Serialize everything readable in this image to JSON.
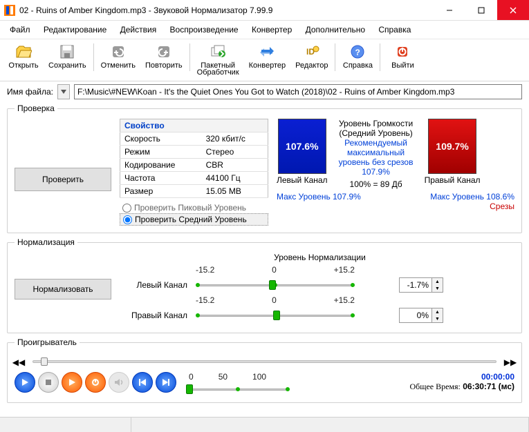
{
  "window": {
    "title": "02 - Ruins of Amber Kingdom.mp3 - Звуковой Нормализатор 7.99.9"
  },
  "menu": {
    "items": [
      "Файл",
      "Редактирование",
      "Действия",
      "Воспроизведение",
      "Конвертер",
      "Дополнительно",
      "Справка"
    ]
  },
  "toolbar": {
    "open": "Открыть",
    "save": "Сохранить",
    "undo": "Отменить",
    "redo": "Повторить",
    "batch_l1": "Пакетный",
    "batch_l2": "Обработчик",
    "converter": "Конвертер",
    "editor": "Редактор",
    "help": "Справка",
    "exit": "Выйти"
  },
  "file": {
    "label": "Имя файла:",
    "path": "F:\\Music\\#NEW\\Koan - It's the Quiet Ones You Got to Watch (2018)\\02 - Ruins of Amber Kingdom.mp3"
  },
  "check": {
    "legend": "Проверка",
    "button": "Проверить",
    "prop_header": "Свойство",
    "rows": {
      "speed_k": "Скорость",
      "speed_v": "320 кбит/с",
      "mode_k": "Режим",
      "mode_v": "Стерео",
      "enc_k": "Кодирование",
      "enc_v": "CBR",
      "freq_k": "Частота",
      "freq_v": "44100 Гц",
      "size_k": "Размер",
      "size_v": "15.05 MB"
    },
    "radio_peak": "Проверить Пиковый Уровень",
    "radio_avg": "Проверить Средний Уровень",
    "meter": {
      "left_label": "Левый Канал",
      "right_label": "Правый Канал",
      "left_value": "107.6%",
      "right_value": "109.7%",
      "loud_l1": "Уровень Громкости",
      "loud_l2": "(Средний Уровень)",
      "rec_l1": "Рекомендуемый",
      "rec_l2": "максимальный",
      "rec_l3": "уровень без срезов",
      "rec_val": "107.9%",
      "eq": "100% = 89 Дб",
      "max_left": "Макс Уровень 107.9%",
      "max_right": "Макс Уровень 108.6%",
      "clips": "Срезы"
    }
  },
  "norm": {
    "legend": "Нормализация",
    "button": "Нормализовать",
    "title": "Уровень Нормализации",
    "scale_min": "-15.2",
    "scale_mid": "0",
    "scale_max": "+15.2",
    "left_label": "Левый Канал",
    "right_label": "Правый Канал",
    "left_value": "-1.7%",
    "right_value": "0%"
  },
  "player": {
    "legend": "Проигрыватель",
    "scale": {
      "a": "0",
      "b": "50",
      "c": "100"
    },
    "current": "00:00:00",
    "total_label": "Общее Время:",
    "total_value": "06:30:71 (мс)"
  }
}
